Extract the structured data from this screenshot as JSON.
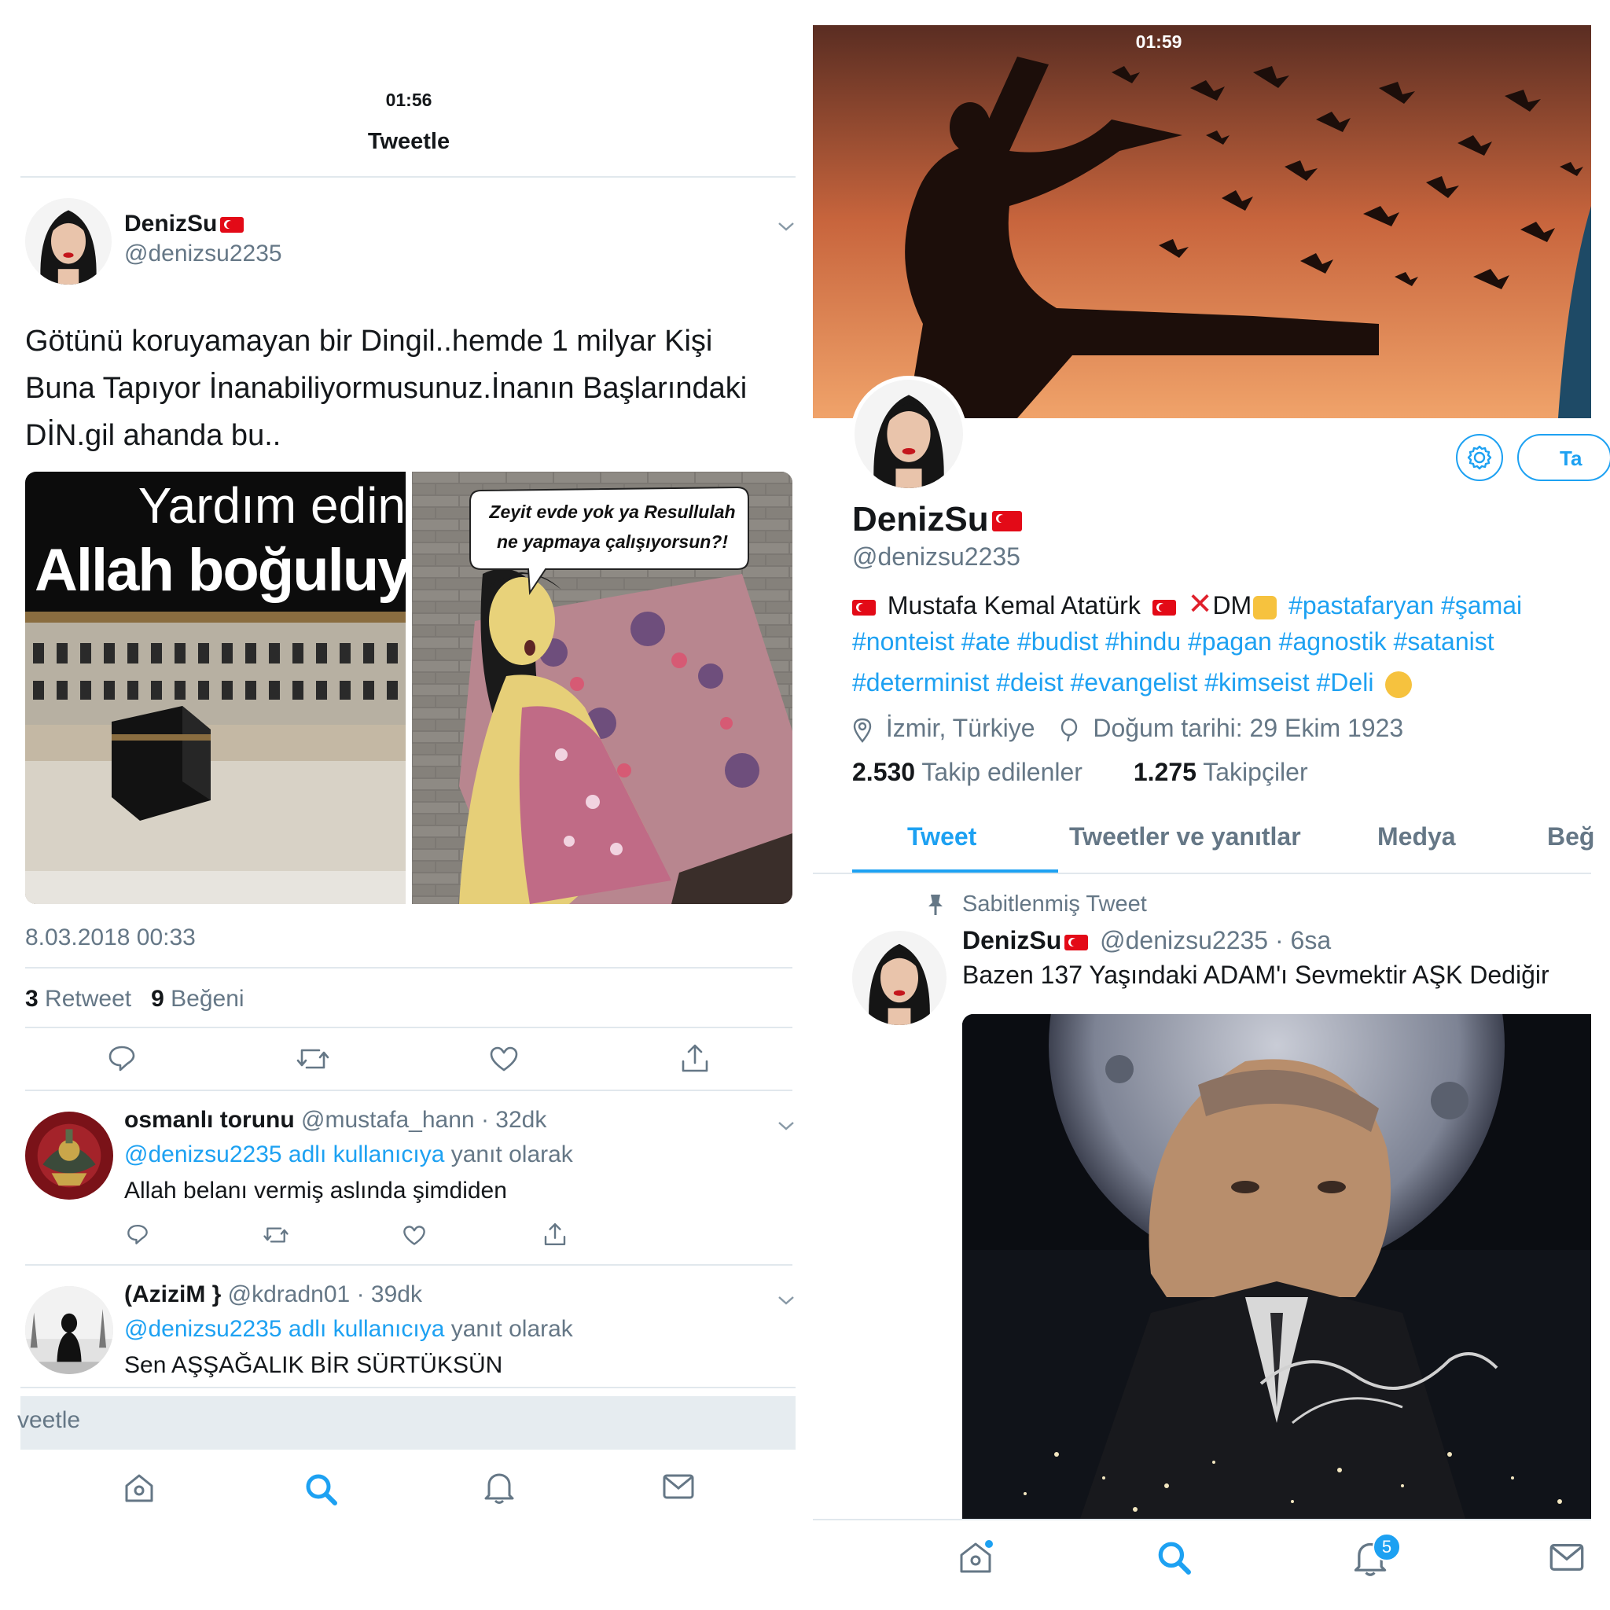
{
  "left": {
    "status_time": "01:56",
    "nav_title": "Tweetle",
    "tweet": {
      "name": "DenizSu",
      "handle": "@denizsu2235",
      "text_lines": [
        "Götünü koruyamayan bir Dingil..hemde 1 milyar Kişi",
        "Buna Tapıyor İnanabiliyormusunuz.İnanın Başlarındaki",
        "DİN.gil ahanda bu.."
      ],
      "image_left_line1": "Yardım edin",
      "image_left_line2": "Allah boğuluy",
      "image_right_bubble_line1": "Zeyit evde yok ya Resullulah",
      "image_right_bubble_line2": "ne yapmaya çalışıyorsun?!",
      "timestamp": "8.03.2018 00:33",
      "retweet_count": "3",
      "retweet_label": "Retweet",
      "like_count": "9",
      "like_label": "Beğeni"
    },
    "replies": [
      {
        "name": "osmanlı torunu",
        "handle": "@mustafa_hann",
        "time": "32dk",
        "reply_to": "@denizsu2235 adlı kullanıcıya",
        "reply_suffix": "yanıt olarak",
        "text": "Allah belanı vermiş aslında şimdiden"
      },
      {
        "name": "(AziziM }",
        "handle": "@kdradn01",
        "time": "39dk",
        "reply_to": "@denizsu2235 adlı kullanıcıya",
        "reply_suffix": "yanıt olarak",
        "text": "Sen AŞŞAĞALIK BİR SÜRTÜKSÜN"
      }
    ],
    "compose_placeholder": "veetle"
  },
  "right": {
    "status_time": "01:59",
    "follow_button_partial": "Ta",
    "profile": {
      "name": "DenizSu",
      "handle": "@denizsu2235",
      "bio_line1_text": "Mustafa Kemal Atatürk",
      "bio_line1_dm": "DM",
      "bio_line1_tags": "#pastafaryan #şamai",
      "bio_line2": "#nonteist #ate #budist #hindu #pagan #agnostik #satanist",
      "bio_line3": "#determinist #deist #evangelist #kimseist #Deli",
      "location": "İzmir, Türkiye",
      "birthday": "Doğum tarihi: 29 Ekim 1923",
      "following_count": "2.530",
      "following_label": "Takip edilenler",
      "followers_count": "1.275",
      "followers_label": "Takipçiler"
    },
    "tabs": [
      "Tweet",
      "Tweetler ve yanıtlar",
      "Medya",
      "Beğ"
    ],
    "active_tab": "Tweet",
    "pinned": {
      "label": "Sabitlenmiş Tweet",
      "name": "DenizSu",
      "handle_time": "@denizsu2235 · 6sa",
      "text": "Bazen 137 Yaşındaki ADAM'ı Sevmektir AŞK Dediğir"
    },
    "notification_badge": "5"
  },
  "colors": {
    "accent": "#1da1f2",
    "text": "#14171a",
    "secondary": "#657786",
    "divider": "#e1e8ed"
  }
}
